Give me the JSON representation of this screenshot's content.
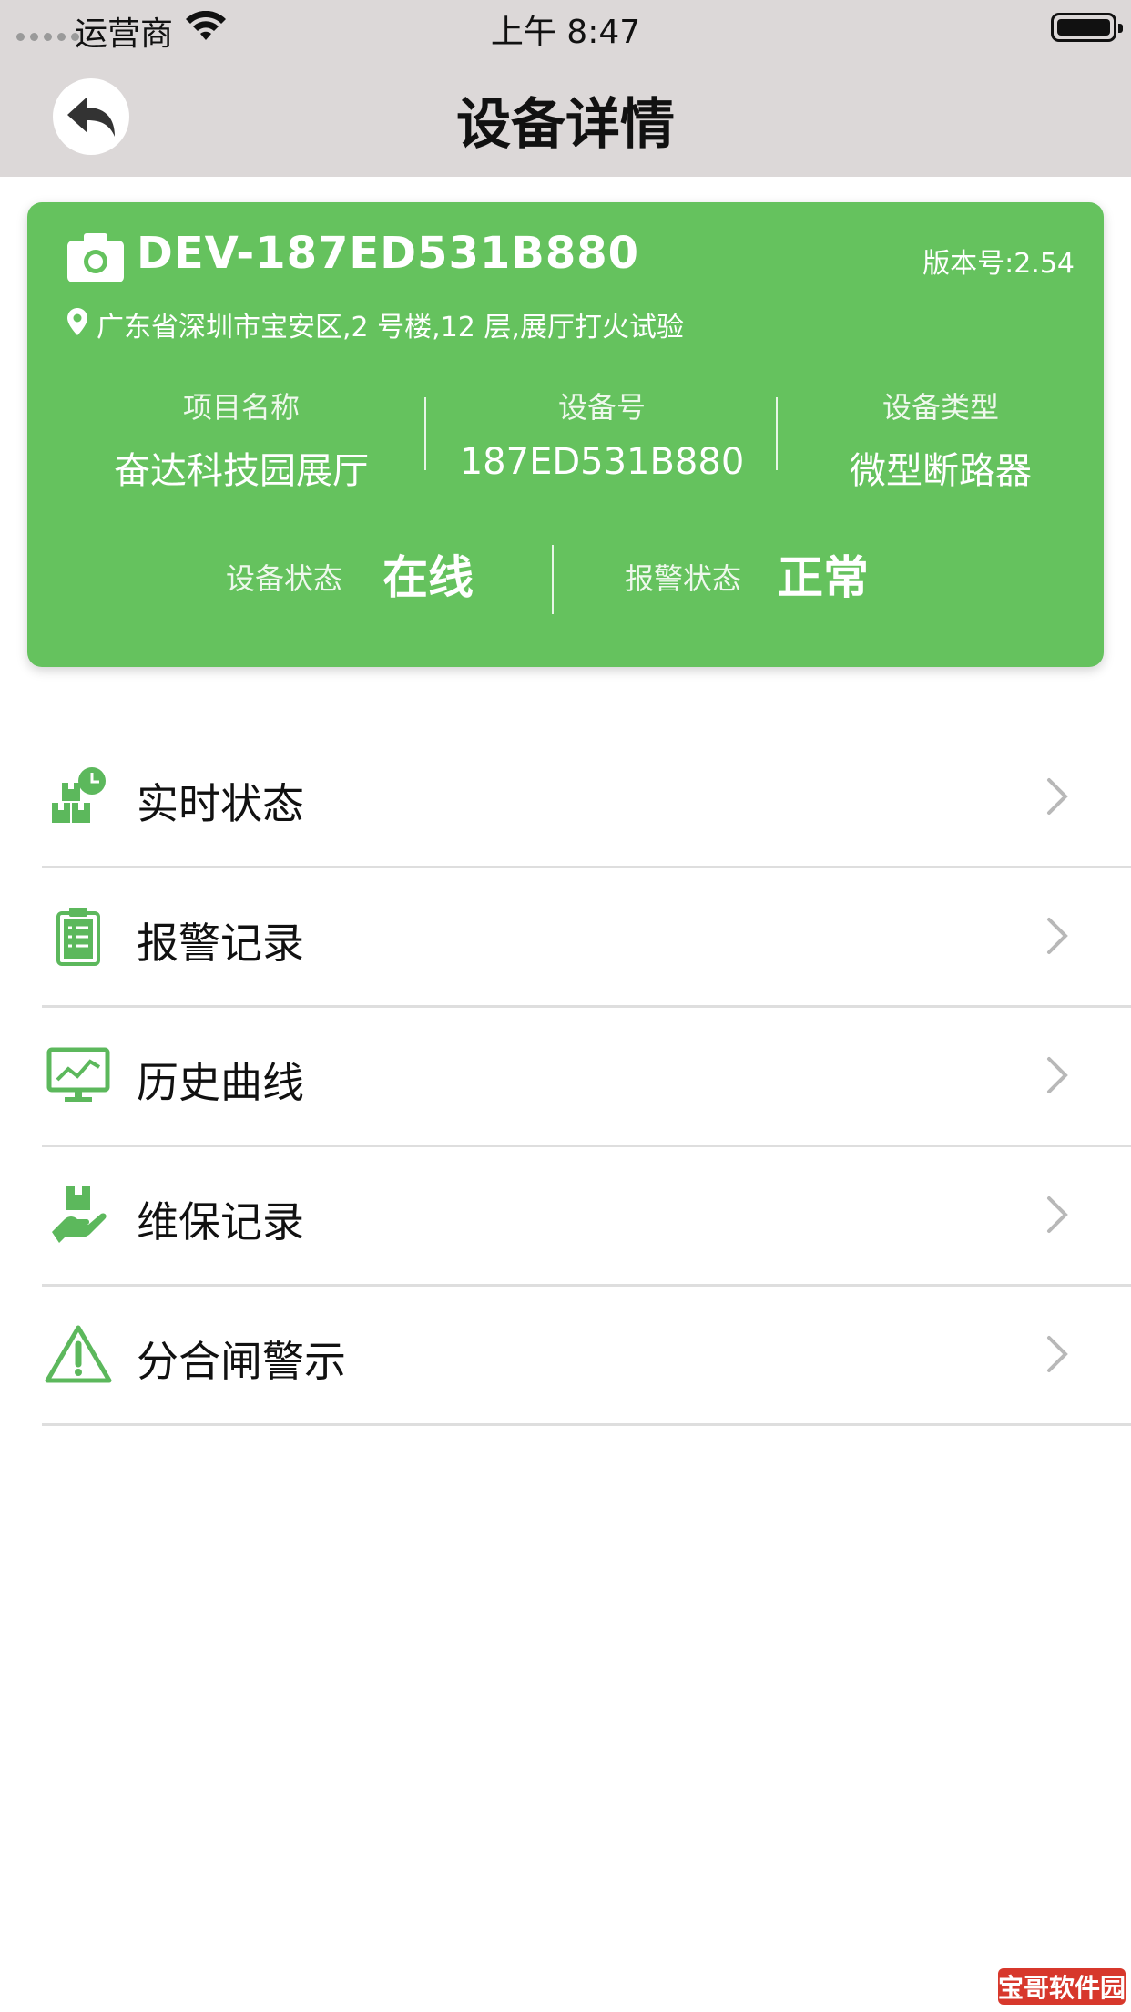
{
  "status_bar": {
    "carrier": "运营商",
    "time": "上午 8:47"
  },
  "nav": {
    "title": "设备详情"
  },
  "device": {
    "id": "DEV-187ED531B880",
    "version": "版本号:2.54",
    "address": "广东省深圳市宝安区,2 号楼,12 层,展厅打火试验",
    "fields": [
      {
        "label": "项目名称",
        "value": "奋达科技园展厅"
      },
      {
        "label": "设备号",
        "value": "187ED531B880"
      },
      {
        "label": "设备类型",
        "value": "微型断路器"
      }
    ],
    "status": {
      "label": "设备状态",
      "value": "在线"
    },
    "alarm": {
      "label": "报警状态",
      "value": "正常"
    }
  },
  "menu": [
    {
      "label": "实时状态",
      "icon": "realtime-status-icon"
    },
    {
      "label": "报警记录",
      "icon": "alarm-record-icon"
    },
    {
      "label": "历史曲线",
      "icon": "history-curve-icon"
    },
    {
      "label": "维保记录",
      "icon": "maintenance-record-icon"
    },
    {
      "label": "分合闸警示",
      "icon": "warning-icon"
    }
  ],
  "watermark": "宝哥软件园",
  "colors": {
    "accent": "#65c25e",
    "header_bg": "#dcd8d8",
    "icon_green": "#5cb85c"
  }
}
